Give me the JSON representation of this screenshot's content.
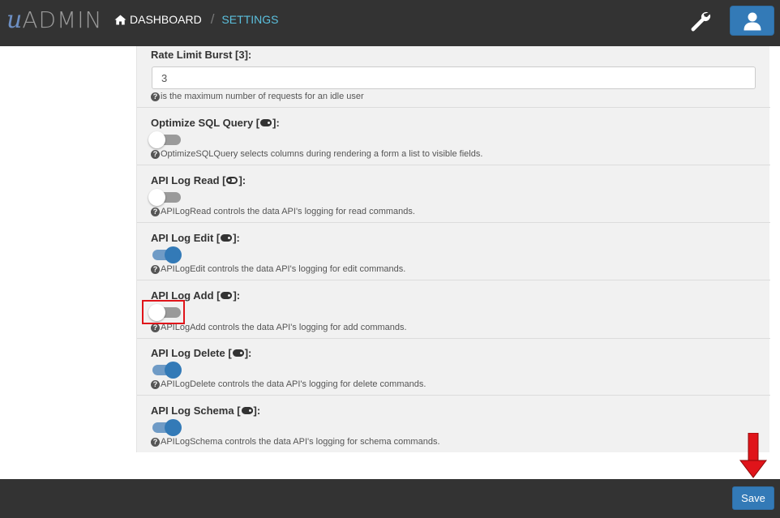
{
  "header": {
    "logo_u": "u",
    "logo_admin": "ADMIN",
    "breadcrumb": {
      "home_label": "DASHBOARD",
      "separator": "/",
      "current_label": "SETTINGS"
    },
    "icons": [
      "home-icon",
      "wrench-icon",
      "user-icon"
    ]
  },
  "settings": {
    "rate_limit_burst": {
      "label": "Rate Limit Burst [3]:",
      "value": "3",
      "help": "is the maximum number of requests for an idle user"
    },
    "optimize_sql": {
      "label_prefix": "Optimize SQL Query [",
      "label_suffix": "]:",
      "help": "OptimizeSQLQuery selects columns during rendering a form a list to visible fields.",
      "enabled": false
    },
    "api_log_read": {
      "label_prefix": "API Log Read [",
      "label_suffix": "]:",
      "help": "APILogRead controls the data API's logging for read commands.",
      "enabled": false
    },
    "api_log_edit": {
      "label_prefix": "API Log Edit [",
      "label_suffix": "]:",
      "help": "APILogEdit controls the data API's logging for edit commands.",
      "enabled": true
    },
    "api_log_add": {
      "label_prefix": "API Log Add [",
      "label_suffix": "]:",
      "help": "APILogAdd controls the data API's logging for add commands.",
      "enabled": false
    },
    "api_log_delete": {
      "label_prefix": "API Log Delete [",
      "label_suffix": "]:",
      "help": "APILogDelete controls the data API's logging for delete commands.",
      "enabled": true
    },
    "api_log_schema": {
      "label_prefix": "API Log Schema [",
      "label_suffix": "]:",
      "help": "APILogSchema controls the data API's logging for schema commands.",
      "enabled": true
    }
  },
  "footer": {
    "save_label": "Save"
  },
  "colors": {
    "topbar": "#333333",
    "primary": "#337ab7",
    "breadcrumb_active": "#5bc0de",
    "highlight": "#e0141a"
  }
}
